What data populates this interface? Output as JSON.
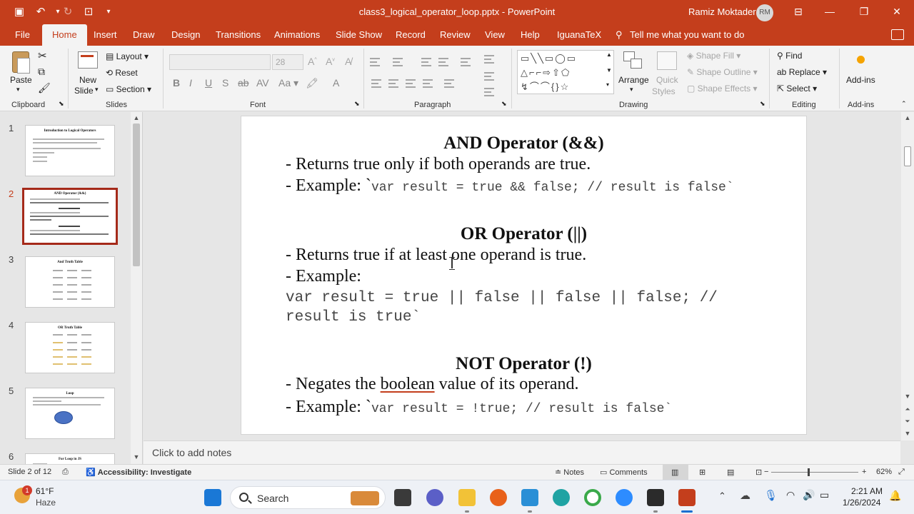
{
  "app": {
    "title": "class3_logical_operator_loop.pptx  -  PowerPoint",
    "user_name": "Ramiz Moktader",
    "user_initials": "RM"
  },
  "tabs": [
    "File",
    "Home",
    "Insert",
    "Draw",
    "Design",
    "Transitions",
    "Animations",
    "Slide Show",
    "Record",
    "Review",
    "View",
    "Help",
    "IguanaTeX"
  ],
  "active_tab": "Home",
  "tell_me": "Tell me what you want to do",
  "ribbon": {
    "clipboard": {
      "label": "Clipboard",
      "paste": "Paste"
    },
    "slides": {
      "label": "Slides",
      "new_slide_1": "New",
      "new_slide_2": "Slide",
      "layout": "Layout",
      "reset": "Reset",
      "section": "Section"
    },
    "font": {
      "label": "Font",
      "size": "28"
    },
    "paragraph": {
      "label": "Paragraph"
    },
    "drawing": {
      "label": "Drawing",
      "arrange": "Arrange",
      "quick_styles_1": "Quick",
      "quick_styles_2": "Styles",
      "shape_fill": "Shape Fill",
      "shape_outline": "Shape Outline",
      "shape_effects": "Shape Effects"
    },
    "editing": {
      "label": "Editing",
      "find": "Find",
      "replace": "Replace",
      "select": "Select"
    },
    "addins": {
      "label": "Add-ins",
      "button": "Add-ins"
    }
  },
  "thumbnails": [
    {
      "num": "1",
      "title": "Introduction to Logical Operators"
    },
    {
      "num": "2",
      "title": "AND Operator (&&)"
    },
    {
      "num": "3",
      "title": "And Truth Table"
    },
    {
      "num": "4",
      "title": "OR Truth Table"
    },
    {
      "num": "5",
      "title": "Loop"
    },
    {
      "num": "6",
      "title": "For Loop in JS"
    }
  ],
  "slide": {
    "and_heading": "AND Operator (&&)",
    "and_line1": "- Returns true only if both operands are true.",
    "and_line2_prefix": "- Example: `",
    "and_line2_code": "var result = true && false; // result is false`",
    "or_heading": "OR Operator (||)",
    "or_line1": "- Returns true if at least one operand is true.",
    "or_line2": "- Example:",
    "or_code1": "var result = true || false || false || false; //",
    "or_code2": "result is true`",
    "not_heading": "NOT Operator (!)",
    "not_line1_a": "- Negates the ",
    "not_line1_b": "boolean",
    "not_line1_c": " value of its operand.",
    "not_line2_prefix": "- Example: `",
    "not_line2_code": "var result = !true; // result is false`"
  },
  "notes_placeholder": "Click to add notes",
  "status": {
    "slide_info": "Slide 2 of 12",
    "accessibility": "Accessibility: Investigate",
    "notes": "Notes",
    "comments": "Comments",
    "zoom": "62%"
  },
  "taskbar": {
    "weather_temp": "61°F",
    "weather_desc": "Haze",
    "weather_badge": "1",
    "search": "Search",
    "time": "2:21 AM",
    "date": "1/26/2024"
  },
  "colors": {
    "accent": "#c43e1c",
    "active_thumb_border": "#a52a1a"
  }
}
